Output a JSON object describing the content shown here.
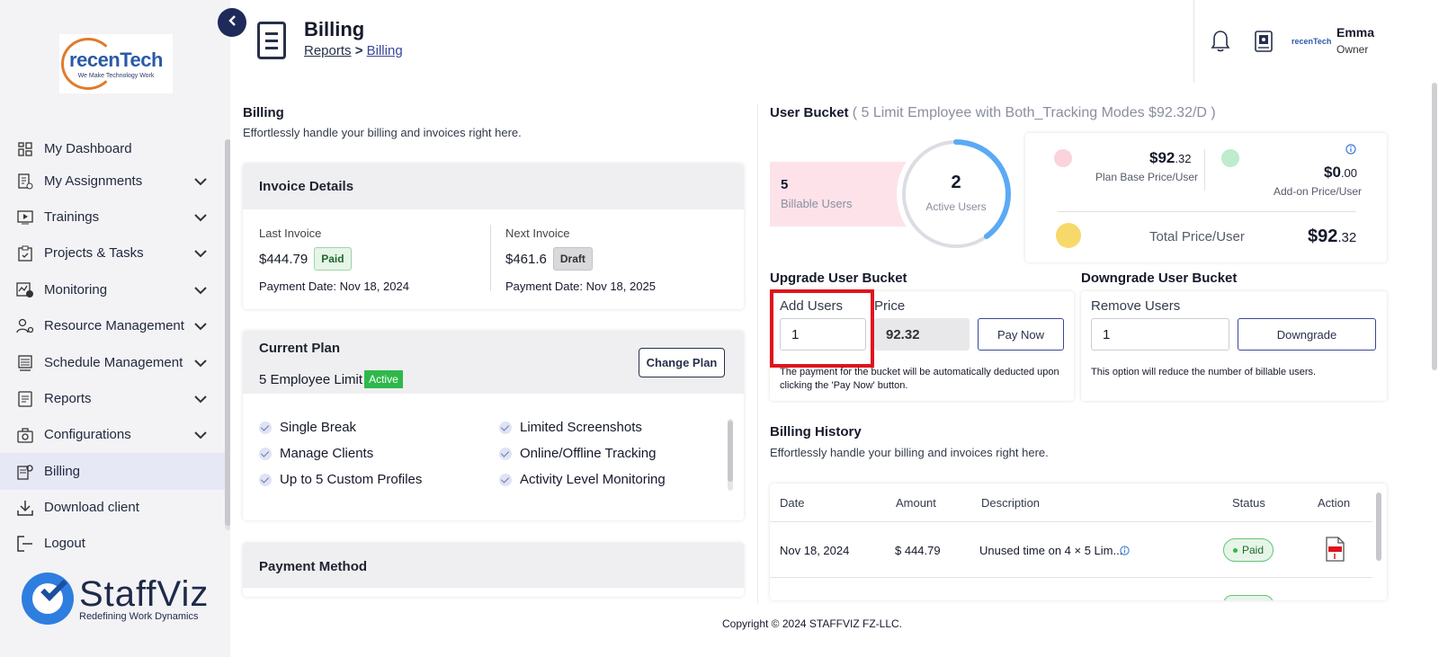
{
  "brand": {
    "top_logo_main": "recenTech",
    "top_logo_tagline": "We Make Technology Work",
    "bottom_logo_name": "StaffViz",
    "bottom_logo_tagline": "Redefining Work Dynamics"
  },
  "sidebar": {
    "items": [
      {
        "label": "My Dashboard",
        "icon": "dashboard-icon",
        "expandable": false
      },
      {
        "label": "My Assignments",
        "icon": "assignments-icon",
        "expandable": true
      },
      {
        "label": "Trainings",
        "icon": "training-icon",
        "expandable": true
      },
      {
        "label": "Projects & Tasks",
        "icon": "clipboard-icon",
        "expandable": true
      },
      {
        "label": "Monitoring",
        "icon": "monitoring-icon",
        "expandable": true
      },
      {
        "label": "Resource Management",
        "icon": "resource-icon",
        "expandable": true
      },
      {
        "label": "Schedule Management",
        "icon": "schedule-icon",
        "expandable": true
      },
      {
        "label": "Reports",
        "icon": "reports-icon",
        "expandable": true
      },
      {
        "label": "Configurations",
        "icon": "configurations-icon",
        "expandable": true
      },
      {
        "label": "Billing",
        "icon": "billing-icon",
        "expandable": false,
        "active": true
      },
      {
        "label": "Download client",
        "icon": "download-icon",
        "expandable": false
      },
      {
        "label": "Logout",
        "icon": "logout-icon",
        "expandable": false
      }
    ]
  },
  "header": {
    "title": "Billing",
    "breadcrumb": [
      "Reports",
      "Billing"
    ],
    "user_name": "Emma",
    "user_role": "Owner",
    "mini_logo": "recenTech"
  },
  "billing": {
    "title": "Billing",
    "subtitle": "Effortlessly handle your billing and invoices right here."
  },
  "invoice": {
    "title": "Invoice Details",
    "last_label": "Last Invoice",
    "last_amount": "$444.79",
    "last_status": "Paid",
    "last_date": "Payment Date: Nov 18, 2024",
    "next_label": "Next Invoice",
    "next_amount": "$461.6",
    "next_status": "Draft",
    "next_date": "Payment Date: Nov 18, 2025"
  },
  "plan": {
    "title": "Current Plan",
    "limit": "5 Employee Limit",
    "status": "Active",
    "change_label": "Change Plan",
    "features_left": [
      "Single Break",
      "Manage Clients",
      "Up to 5 Custom Profiles"
    ],
    "features_right": [
      "Limited Screenshots",
      "Online/Offline Tracking",
      "Activity Level Monitoring"
    ]
  },
  "payment": {
    "title": "Payment Method"
  },
  "bucket": {
    "title": "User Bucket",
    "detail": "( 5 Limit Employee with Both_Tracking Modes $92.32/D )",
    "billable_count": "5",
    "billable_label": "Billable Users",
    "active_count": "2",
    "active_label": "Active Users",
    "active_fraction": 0.4,
    "plan_base_price_main": "$92",
    "plan_base_price_cents": ".32",
    "plan_base_label": "Plan Base Price/User",
    "addon_price_main": "$0",
    "addon_price_cents": ".00",
    "addon_label": "Add-on Price/User",
    "total_label": "Total Price/User",
    "total_main": "$92",
    "total_cents": ".32"
  },
  "upgrade": {
    "title": "Upgrade User Bucket",
    "add_users_label": "Add Users",
    "add_users_value": "1",
    "price_label": "Price",
    "price_value": "92.32",
    "pay_label": "Pay Now",
    "note": "The payment for the bucket will be automatically deducted upon clicking the 'Pay Now' button."
  },
  "downgrade": {
    "title": "Downgrade User Bucket",
    "remove_users_label": "Remove Users",
    "remove_users_value": "1",
    "downgrade_label": "Downgrade",
    "note": "This option will reduce the number of billable users."
  },
  "history": {
    "title": "Billing History",
    "subtitle": "Effortlessly handle your billing and invoices right here.",
    "columns": [
      "Date",
      "Amount",
      "Description",
      "Status",
      "Action"
    ],
    "rows": [
      {
        "date": "Nov 18, 2024",
        "amount": "$ 444.79",
        "description": "Unused time on 4 × 5 Lim...",
        "status": "Paid"
      }
    ]
  },
  "footer": {
    "copyright": "Copyright © 2024 STAFFVIZ FZ-LLC."
  },
  "colors": {
    "accent": "#1e2a5a",
    "active_green": "#2fb84a",
    "ring_blue": "#5aaaf5",
    "highlight_red": "#e0141c"
  }
}
